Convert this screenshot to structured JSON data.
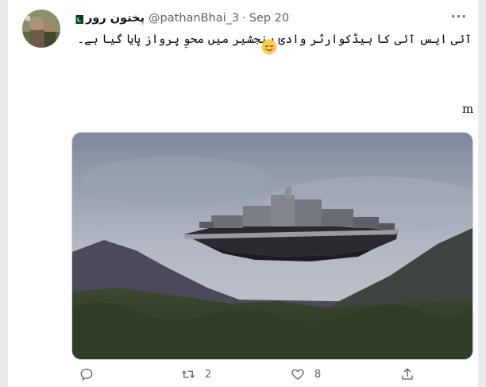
{
  "tweet": {
    "author_name": "پختون رور",
    "handle": "@pathanBhai_3",
    "separator": "·",
    "date": "Sep 20",
    "more_label": "···",
    "text": "آئی ایس آئی کا ہیڈکوارٹر وادیٔ پنجشیر میں محوِ پرواز پایا گیا ہے۔",
    "trailing_char": "m",
    "emoji": "relieved-face-emoji",
    "media": "photo of a floating city above a mountain valley"
  },
  "actions": {
    "reply_count": "",
    "retweet_count": "2",
    "like_count": "8",
    "share_count": ""
  },
  "icons": {
    "flag": "pakistan-flag-icon",
    "reply": "reply-icon",
    "retweet": "retweet-icon",
    "like": "heart-icon",
    "share": "share-icon"
  },
  "colors": {
    "text": "#0f1419",
    "secondary": "#536471",
    "border": "#cfd9de"
  }
}
